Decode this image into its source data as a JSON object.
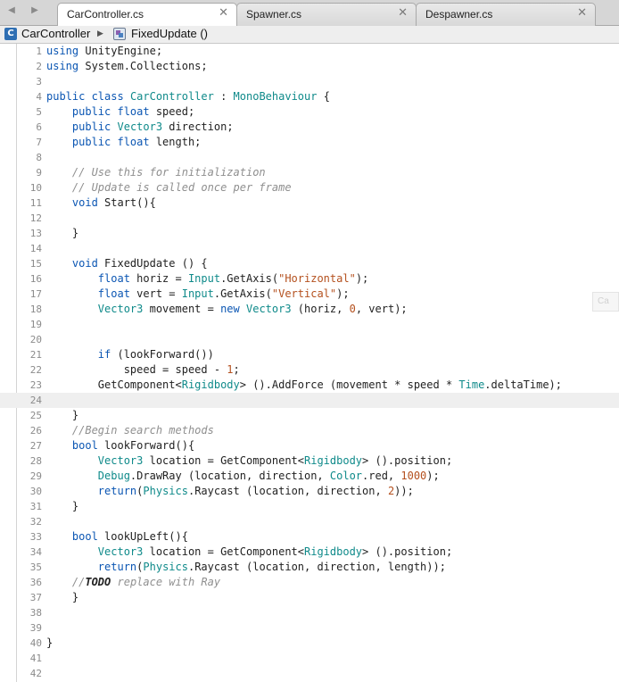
{
  "tabs": [
    {
      "label": "CarController.cs",
      "active": true
    },
    {
      "label": "Spawner.cs",
      "active": false
    },
    {
      "label": "Despawner.cs",
      "active": false
    }
  ],
  "nav": {
    "back_icon": "◀",
    "forward_icon": "▶"
  },
  "close_icon": "✕",
  "breadcrumb": {
    "class_icon_glyph": "C",
    "class_name": "CarController",
    "separator": "▶",
    "method_name": "FixedUpdate ()"
  },
  "editor": {
    "current_line": 24,
    "hint_text": "Ca",
    "lines": [
      [
        [
          "kw",
          "using"
        ],
        [
          "txt",
          " UnityEngine;"
        ]
      ],
      [
        [
          "kw",
          "using"
        ],
        [
          "txt",
          " System.Collections;"
        ]
      ],
      [],
      [
        [
          "kw",
          "public class"
        ],
        [
          "txt",
          " "
        ],
        [
          "ty",
          "CarController"
        ],
        [
          "txt",
          " : "
        ],
        [
          "ty",
          "MonoBehaviour"
        ],
        [
          "txt",
          " {"
        ]
      ],
      [
        [
          "txt",
          "    "
        ],
        [
          "kw",
          "public float"
        ],
        [
          "txt",
          " speed;"
        ]
      ],
      [
        [
          "txt",
          "    "
        ],
        [
          "kw",
          "public"
        ],
        [
          "txt",
          " "
        ],
        [
          "ty",
          "Vector3"
        ],
        [
          "txt",
          " direction;"
        ]
      ],
      [
        [
          "txt",
          "    "
        ],
        [
          "kw",
          "public float"
        ],
        [
          "txt",
          " length;"
        ]
      ],
      [],
      [
        [
          "txt",
          "    "
        ],
        [
          "cm",
          "// Use this for initialization"
        ]
      ],
      [
        [
          "txt",
          "    "
        ],
        [
          "cm",
          "// Update is called once per frame"
        ]
      ],
      [
        [
          "txt",
          "    "
        ],
        [
          "kw",
          "void"
        ],
        [
          "txt",
          " Start(){"
        ]
      ],
      [],
      [
        [
          "txt",
          "    }"
        ]
      ],
      [],
      [
        [
          "txt",
          "    "
        ],
        [
          "kw",
          "void"
        ],
        [
          "txt",
          " FixedUpdate () {"
        ]
      ],
      [
        [
          "txt",
          "        "
        ],
        [
          "kw",
          "float"
        ],
        [
          "txt",
          " horiz = "
        ],
        [
          "ty",
          "Input"
        ],
        [
          "txt",
          ".GetAxis("
        ],
        [
          "str",
          "\"Horizontal\""
        ],
        [
          "txt",
          ");"
        ]
      ],
      [
        [
          "txt",
          "        "
        ],
        [
          "kw",
          "float"
        ],
        [
          "txt",
          " vert = "
        ],
        [
          "ty",
          "Input"
        ],
        [
          "txt",
          ".GetAxis("
        ],
        [
          "str",
          "\"Vertical\""
        ],
        [
          "txt",
          ");"
        ]
      ],
      [
        [
          "txt",
          "        "
        ],
        [
          "ty",
          "Vector3"
        ],
        [
          "txt",
          " movement = "
        ],
        [
          "kw",
          "new"
        ],
        [
          "txt",
          " "
        ],
        [
          "ty",
          "Vector3"
        ],
        [
          "txt",
          " (horiz, "
        ],
        [
          "num",
          "0"
        ],
        [
          "txt",
          ", vert);"
        ]
      ],
      [],
      [],
      [
        [
          "txt",
          "        "
        ],
        [
          "kw",
          "if"
        ],
        [
          "txt",
          " (lookForward())"
        ]
      ],
      [
        [
          "txt",
          "            speed = speed - "
        ],
        [
          "num",
          "1"
        ],
        [
          "txt",
          ";"
        ]
      ],
      [
        [
          "txt",
          "        GetComponent<"
        ],
        [
          "ty",
          "Rigidbody"
        ],
        [
          "txt",
          "> ().AddForce (movement * speed * "
        ],
        [
          "ty",
          "Time"
        ],
        [
          "txt",
          ".deltaTime);"
        ]
      ],
      [],
      [
        [
          "txt",
          "    }"
        ]
      ],
      [
        [
          "txt",
          "    "
        ],
        [
          "cm",
          "//Begin search methods"
        ]
      ],
      [
        [
          "txt",
          "    "
        ],
        [
          "kw",
          "bool"
        ],
        [
          "txt",
          " lookForward(){"
        ]
      ],
      [
        [
          "txt",
          "        "
        ],
        [
          "ty",
          "Vector3"
        ],
        [
          "txt",
          " location = GetComponent<"
        ],
        [
          "ty",
          "Rigidbody"
        ],
        [
          "txt",
          "> ().position;"
        ]
      ],
      [
        [
          "txt",
          "        "
        ],
        [
          "ty",
          "Debug"
        ],
        [
          "txt",
          ".DrawRay (location, direction, "
        ],
        [
          "ty",
          "Color"
        ],
        [
          "txt",
          ".red, "
        ],
        [
          "num",
          "1000"
        ],
        [
          "txt",
          ");"
        ]
      ],
      [
        [
          "txt",
          "        "
        ],
        [
          "kw",
          "return"
        ],
        [
          "txt",
          "("
        ],
        [
          "ty",
          "Physics"
        ],
        [
          "txt",
          ".Raycast (location, direction, "
        ],
        [
          "num",
          "2"
        ],
        [
          "txt",
          "));"
        ]
      ],
      [
        [
          "txt",
          "    }"
        ]
      ],
      [],
      [
        [
          "txt",
          "    "
        ],
        [
          "kw",
          "bool"
        ],
        [
          "txt",
          " lookUpLeft(){"
        ]
      ],
      [
        [
          "txt",
          "        "
        ],
        [
          "ty",
          "Vector3"
        ],
        [
          "txt",
          " location = GetComponent<"
        ],
        [
          "ty",
          "Rigidbody"
        ],
        [
          "txt",
          "> ().position;"
        ]
      ],
      [
        [
          "txt",
          "        "
        ],
        [
          "kw",
          "return"
        ],
        [
          "txt",
          "("
        ],
        [
          "ty",
          "Physics"
        ],
        [
          "txt",
          ".Raycast (location, direction, length));"
        ]
      ],
      [
        [
          "txt",
          "    "
        ],
        [
          "cm",
          "//"
        ],
        [
          "cmb",
          "TODO"
        ],
        [
          "cm",
          " replace with Ray"
        ]
      ],
      [
        [
          "txt",
          "    }"
        ]
      ],
      [],
      [],
      [
        [
          "txt",
          "}"
        ]
      ],
      [],
      []
    ]
  }
}
